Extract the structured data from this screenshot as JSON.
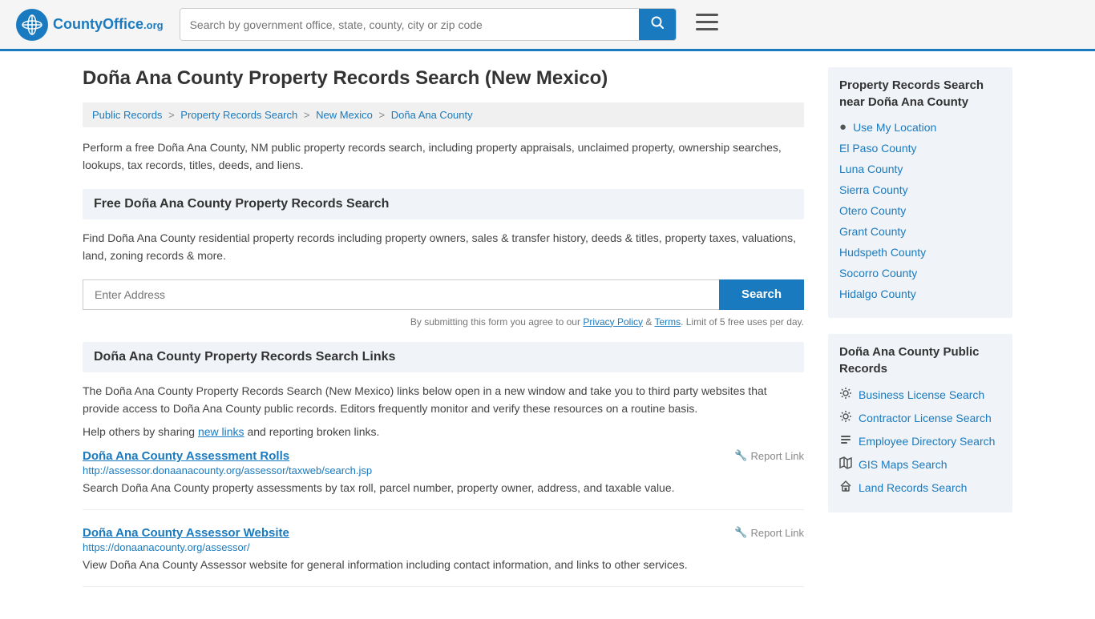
{
  "header": {
    "logo_icon": "🌐",
    "logo_county": "County",
    "logo_office": "Office",
    "logo_org": ".org",
    "search_placeholder": "Search by government office, state, county, city or zip code",
    "search_button_icon": "🔍",
    "hamburger_icon": "≡"
  },
  "page": {
    "title": "Doña Ana County Property Records Search (New Mexico)"
  },
  "breadcrumb": {
    "items": [
      {
        "label": "Public Records",
        "href": "#"
      },
      {
        "label": "Property Records Search",
        "href": "#"
      },
      {
        "label": "New Mexico",
        "href": "#"
      },
      {
        "label": "Doña Ana County",
        "href": "#"
      }
    ]
  },
  "description": "Perform a free Doña Ana County, NM public property records search, including property appraisals, unclaimed property, ownership searches, lookups, tax records, titles, deeds, and liens.",
  "free_search": {
    "title": "Free Doña Ana County Property Records Search",
    "body": "Find Doña Ana County residential property records including property owners, sales & transfer history, deeds & titles, property taxes, valuations, land, zoning records & more.",
    "address_placeholder": "Enter Address",
    "search_button": "Search",
    "form_note_pre": "By submitting this form you agree to our ",
    "privacy_policy_label": "Privacy Policy",
    "and_label": "& ",
    "terms_label": "Terms",
    "form_note_post": ". Limit of 5 free uses per day."
  },
  "links_section": {
    "title": "Doña Ana County Property Records Search Links",
    "body": "The Doña Ana County Property Records Search (New Mexico) links below open in a new window and take you to third party websites that provide access to Doña Ana County public records. Editors frequently monitor and verify these resources on a routine basis.",
    "new_links_note_pre": "Help others by sharing ",
    "new_links_label": "new links",
    "new_links_note_post": " and reporting broken links.",
    "links": [
      {
        "title": "Doña Ana County Assessment Rolls",
        "url": "http://assessor.donaanacounty.org/assessor/taxweb/search.jsp",
        "desc": "Search Doña Ana County property assessments by tax roll, parcel number, property owner, address, and taxable value.",
        "report_label": "Report Link",
        "report_icon": "🔧"
      },
      {
        "title": "Doña Ana County Assessor Website",
        "url": "https://donaanacounty.org/assessor/",
        "desc": "View Doña Ana County Assessor website for general information including contact information, and links to other services.",
        "report_label": "Report Link",
        "report_icon": "🔧"
      }
    ]
  },
  "sidebar": {
    "nearby_title": "Property Records Search near Doña Ana County",
    "nearby_links": [
      {
        "label": "Use My Location",
        "icon": "📍"
      },
      {
        "label": "El Paso County",
        "icon": ""
      },
      {
        "label": "Luna County",
        "icon": ""
      },
      {
        "label": "Sierra County",
        "icon": ""
      },
      {
        "label": "Otero County",
        "icon": ""
      },
      {
        "label": "Grant County",
        "icon": ""
      },
      {
        "label": "Hudspeth County",
        "icon": ""
      },
      {
        "label": "Socorro County",
        "icon": ""
      },
      {
        "label": "Hidalgo County",
        "icon": ""
      }
    ],
    "public_records_title": "Doña Ana County Public Records",
    "public_records_links": [
      {
        "label": "Business License Search",
        "icon": "⚙"
      },
      {
        "label": "Contractor License Search",
        "icon": "⚙"
      },
      {
        "label": "Employee Directory Search",
        "icon": "📋"
      },
      {
        "label": "GIS Maps Search",
        "icon": "🗺"
      },
      {
        "label": "Land Records Search",
        "icon": "🏠"
      }
    ]
  }
}
